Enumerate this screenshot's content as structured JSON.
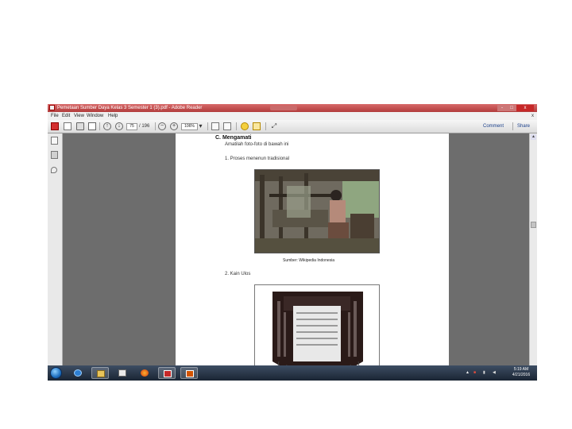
{
  "window": {
    "title": "Pemetaan Sumber Daya Kelas 3 Semester 1 (3).pdf - Adobe Reader",
    "controls": [
      "-",
      "□",
      "x"
    ]
  },
  "menu": [
    "File",
    "Edit",
    "View",
    "Window",
    "Help"
  ],
  "menu_close": "x",
  "toolbar": {
    "page_current": "75",
    "page_total": "/ 196",
    "zoom": "106%",
    "comment_label": "Comment",
    "share_label": "Share"
  },
  "document": {
    "heading": "C.  Mengamati",
    "intro": "Amatilah foto-foto di bawah ini",
    "item1": "1.   Proses menenun tradisional",
    "caption": "Sumber: Wikipedia Indonesia",
    "item2": "2.   Kain Ulos"
  },
  "taskbar": {
    "apps": [
      "start-button",
      "internet-explorer",
      "windows-explorer",
      "media-player",
      "firefox",
      "adobe-reader",
      "powerpoint"
    ],
    "tray_icons": [
      "show-hidden",
      "action-center",
      "network",
      "volume"
    ],
    "time": "5:19 AM",
    "date": "4/21/2016"
  },
  "colors": {
    "titlebar": "#c0392b",
    "document_bg": "#6d6d6d",
    "taskbar": "#1f2b3a"
  }
}
